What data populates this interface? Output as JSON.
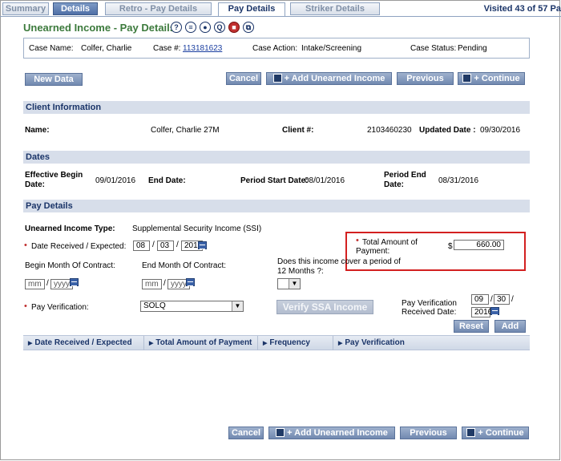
{
  "tabs": [
    "Summary",
    "Details",
    "Retro - Pay Details",
    "Pay Details",
    "Striker Details"
  ],
  "visited": "Visited 43 of 57 Pa",
  "title": "Unearned Income - Pay Details",
  "case": {
    "name_label": "Case Name:",
    "name": "Colfer, Charlie",
    "number_label": "Case #:",
    "number": "113181623",
    "action_label": "Case Action:",
    "action": "Intake/Screening",
    "status_label": "Case Status:",
    "status": "Pending"
  },
  "buttons": {
    "new_data": "New Data",
    "cancel": "Cancel",
    "add": "+ Add Unearned Income",
    "previous": "Previous",
    "continue": "+ Continue",
    "reset": "Reset",
    "add_small": "Add",
    "verify": "Verify SSA Income"
  },
  "client": {
    "section": "Client Information",
    "name_label": "Name:",
    "name": "Colfer, Charlie 27M",
    "client_label": "Client #:",
    "client_no": "2103460230",
    "updated_label": "Updated Date :",
    "updated": "09/30/2016"
  },
  "dates": {
    "section": "Dates",
    "eff_label_1": "Effective Begin",
    "eff_label_2": "Date:",
    "eff": "09/01/2016",
    "end_label": "End Date:",
    "period_start_label": "Period Start Date:",
    "period_start": "08/01/2016",
    "period_end_label_1": "Period End",
    "period_end_label_2": "Date:",
    "period_end": "08/31/2016"
  },
  "pay": {
    "section": "Pay Details",
    "type_label": "Unearned Income Type:",
    "type": "Supplemental Security Income (SSI)",
    "date_recv_label": "Date Received / Expected:",
    "recv_mm": "08",
    "recv_dd": "03",
    "recv_yyyy": "2016",
    "total_label_1": "Total Amount of",
    "total_label_2": "Payment:",
    "currency": "$",
    "total": "660.00",
    "begin_month_label": "Begin Month Of Contract:",
    "end_month_label": "End Month Of Contract:",
    "mm_ph": "mm",
    "yyyy_ph": "yyyy",
    "cover_label_1": "Does this income cover a period of",
    "cover_label_2": "12 Months ?:",
    "verif_label": "Pay Verification:",
    "verif": "SOLQ",
    "verif_date_label_1": "Pay Verification",
    "verif_date_label_2": "Received Date:",
    "vd_mm": "09",
    "vd_dd": "30",
    "vd_yyyy": "2016"
  },
  "grid": {
    "columns": [
      "Date Received / Expected",
      "Total Amount of Payment",
      "Frequency",
      "Pay Verification"
    ]
  },
  "icons": [
    "help-icon",
    "list-icon",
    "person-icon",
    "question-icon",
    "stop-icon",
    "copy-icon"
  ]
}
